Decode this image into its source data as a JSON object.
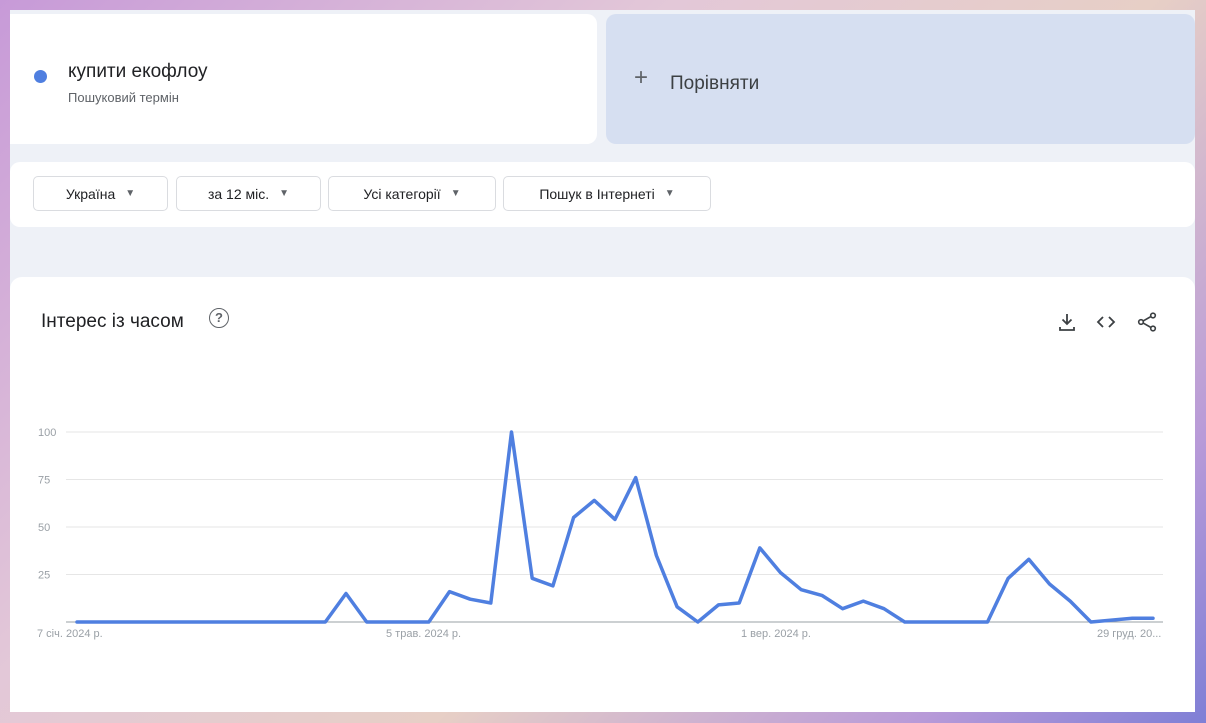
{
  "term": {
    "name": "купити екофлоу",
    "type": "Пошуковий термін",
    "color": "#4f7fe0"
  },
  "compare": {
    "label": "Порівняти"
  },
  "filters": [
    {
      "label": "Україна"
    },
    {
      "label": "за 12 міс."
    },
    {
      "label": "Усі категорії"
    },
    {
      "label": "Пошук в Інтернеті"
    }
  ],
  "chart": {
    "title": "Інтерес із часом",
    "toolbar": [
      "download-icon",
      "embed-icon",
      "share-icon"
    ]
  },
  "chart_data": {
    "type": "line",
    "ylim": [
      0,
      100
    ],
    "yticks": [
      25,
      50,
      75,
      100
    ],
    "xtick_labels": [
      "7 січ. 2024 р.",
      "5 трав. 2024 р.",
      "1 вер. 2024 р.",
      "29 груд. 20..."
    ],
    "grid": true,
    "series": [
      {
        "name": "купити екофлоу",
        "color": "#4f7fe0",
        "values": [
          0,
          0,
          0,
          0,
          0,
          0,
          0,
          0,
          0,
          0,
          0,
          0,
          0,
          15,
          0,
          0,
          0,
          0,
          16,
          12,
          10,
          100,
          23,
          19,
          55,
          64,
          54,
          76,
          35,
          8,
          0,
          9,
          10,
          39,
          26,
          17,
          14,
          7,
          11,
          7,
          0,
          0,
          0,
          0,
          0,
          23,
          33,
          20,
          11,
          0,
          1,
          2,
          2
        ]
      }
    ]
  }
}
